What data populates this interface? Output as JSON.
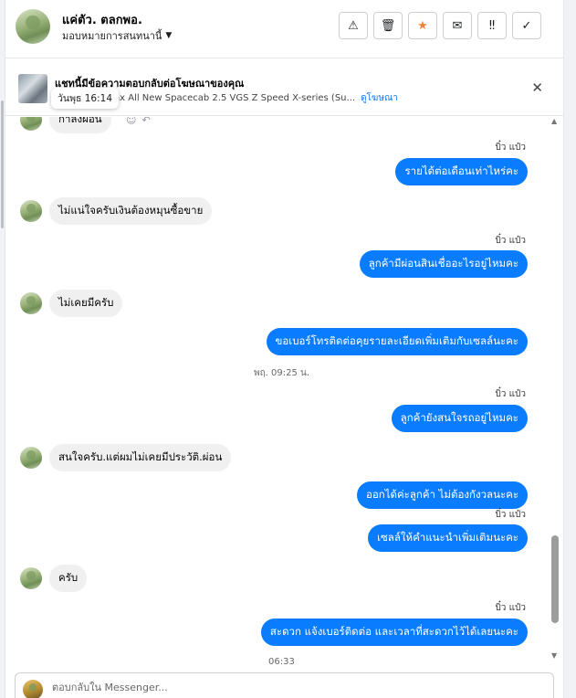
{
  "header": {
    "contact_name": "แค่ตัว. ตลกพอ.",
    "assign_label": "มอบหมายการสนทนานี้",
    "tools": [
      {
        "icon": "warning-icon",
        "glyph": "⚠"
      },
      {
        "icon": "trash-icon",
        "glyph": "🗑"
      },
      {
        "icon": "star-icon",
        "glyph": "★"
      },
      {
        "icon": "mail-icon",
        "glyph": "✉"
      },
      {
        "icon": "priority-icon",
        "glyph": "‼"
      },
      {
        "icon": "check-icon",
        "glyph": "✓"
      }
    ]
  },
  "ad": {
    "title": "แชทนี้มีข้อความตอบกลับต่อโฆษณาของคุณ",
    "subtitle": "ax All New Spacecab 2.5 VGS Z Speed X-series (Su...",
    "link": "ดูโฆษณา",
    "timestamp_tooltip": "วันพุธ 16:14",
    "close_glyph": "✕"
  },
  "messages": {
    "partial_left": "กำลังผ่อน",
    "seen1": "บิ๋ว แป๋ว",
    "out1": "รายได้ต่อเดือนเท่าไหร่คะ",
    "in1": "ไม่แน่ใจครับเงินต้องหมุนซื้อขาย",
    "seen2": "บิ๋ว แป๋ว",
    "out2": "ลูกค้ามีผ่อนสินเชื่ออะไรอยู่ไหมคะ",
    "in2": "ไม่เคยมีครับ",
    "out3": "ขอเบอร์โทรติดต่อคุยรายละเอียดเพิ่มเติมกับเซลล์นะคะ",
    "day_stamp": "พฤ. 09:25 น.",
    "seen3": "บิ๋ว แป๋ว",
    "out4": "ลูกค้ายังสนใจรถอยู่ไหมคะ",
    "in3": "สนใจครับ.แต่ผมไม่เคยมีประวัติ.ผ่อน",
    "out5": "ออกได้ค่ะลูกค้า  ไม่ต้องกังวลนะคะ",
    "seen4": "บิ๋ว แป๋ว",
    "out6": "เซลล์ให้คำแนะนำเพิ่มเติมนะคะ",
    "in4": "ครับ",
    "seen5": "บิ๋ว แป๋ว",
    "out7": "สะดวก แจ้งเบอร์ติดต่อ  และเวลาที่สะดวกไว้ได้เลยนะคะ",
    "partial_stamp": "06:33"
  },
  "composer": {
    "placeholder": "ตอบกลับใน Messenger..."
  }
}
